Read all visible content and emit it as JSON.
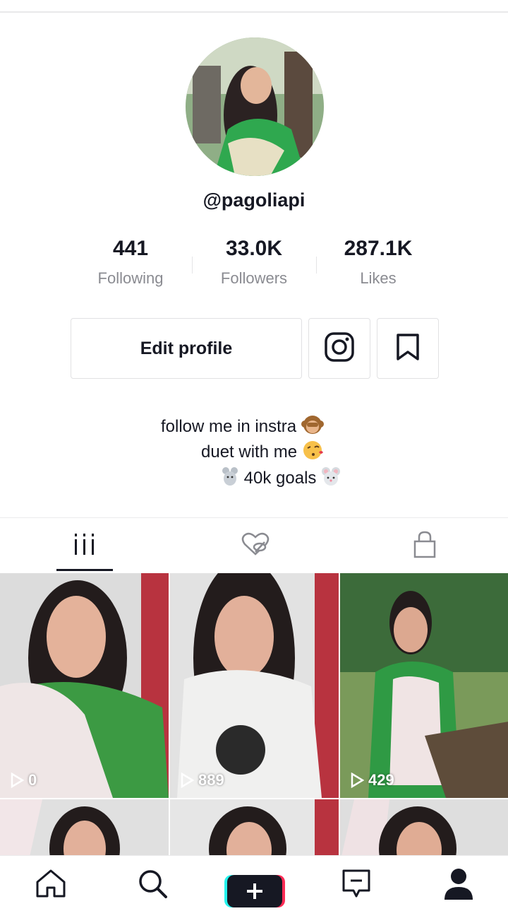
{
  "profile": {
    "username": "@pagoliapi",
    "stats": [
      {
        "value": "441",
        "label": "Following"
      },
      {
        "value": "33.0K",
        "label": "Followers"
      },
      {
        "value": "287.1K",
        "label": "Likes"
      }
    ],
    "edit_button": "Edit profile",
    "bio": [
      "follow me in instra",
      "duet with me",
      "40k goals"
    ]
  },
  "icons": {
    "instagram": "instagram-icon",
    "bookmark": "bookmark-icon",
    "tabs": [
      "grid-icon",
      "liked-icon",
      "lock-icon"
    ],
    "nav": [
      "home-icon",
      "search-icon",
      "plus-icon",
      "inbox-icon",
      "profile-icon"
    ]
  },
  "videos": [
    {
      "views": "0"
    },
    {
      "views": "889"
    },
    {
      "views": "429"
    },
    {
      "views": ""
    },
    {
      "views": ""
    },
    {
      "views": ""
    }
  ],
  "colors": {
    "accent": "#161823",
    "muted": "#8a8b91",
    "tiktok_cyan": "#25f4ee",
    "tiktok_red": "#fe2c55"
  }
}
